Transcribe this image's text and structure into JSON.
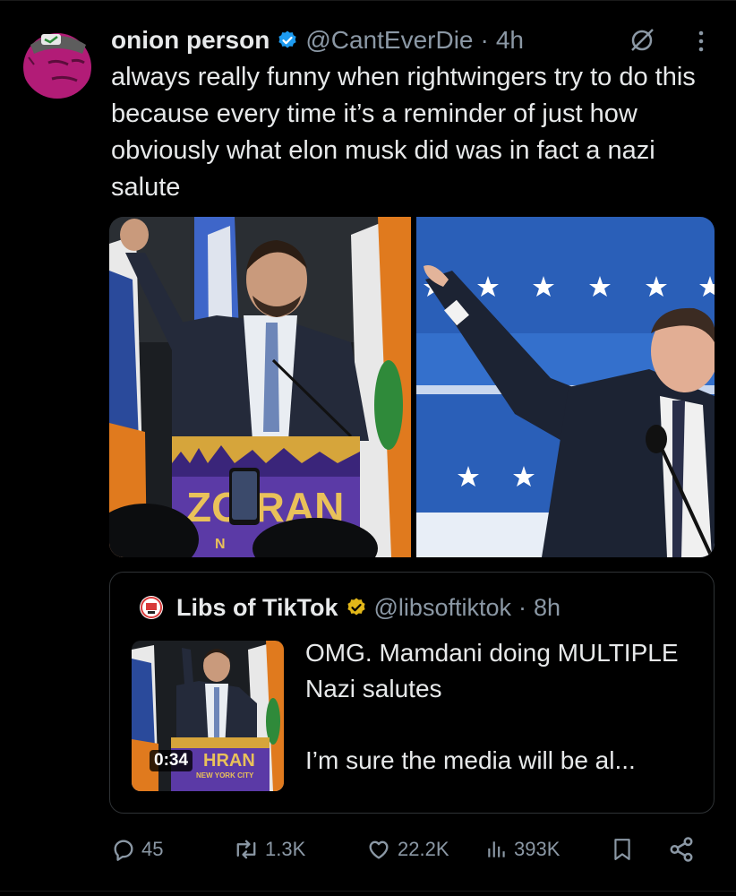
{
  "post": {
    "display_name": "onion person",
    "handle": "@CantEverDie",
    "separator": "·",
    "time": "4h",
    "text": "always really funny when rightwingers try to do this because every time it’s a reminder of just how obviously what elon musk did was in fact a nazi salute"
  },
  "left_image": {
    "podium_text": "ZO  RAN",
    "podium_sub": "N"
  },
  "quoted": {
    "display_name": "Libs of TikTok",
    "handle": "@libsoftiktok",
    "separator": "·",
    "time": "8h",
    "text_line1": "OMG. Mamdani doing MULTIPLE Nazi salutes",
    "text_line2": "I’m sure the media will be al...",
    "video_duration": "0:34",
    "thumb_podium_text": "HRAN",
    "thumb_podium_sub": "NEW YORK CITY"
  },
  "actions": {
    "replies": "45",
    "reposts": "1.3K",
    "likes": "22.2K",
    "views": "393K"
  },
  "colors": {
    "background": "#000000",
    "text": "#e7e9ea",
    "muted": "#8b98a5",
    "verified_blue": "#1d9bf0",
    "verified_gold": "#e2b719",
    "border": "#2f3336"
  },
  "icons": [
    "avatar",
    "verified-badge-icon",
    "edited-icon",
    "more-icon",
    "gold-verified-icon",
    "reply-icon",
    "repost-icon",
    "like-icon",
    "views-icon",
    "bookmark-icon",
    "share-icon"
  ]
}
